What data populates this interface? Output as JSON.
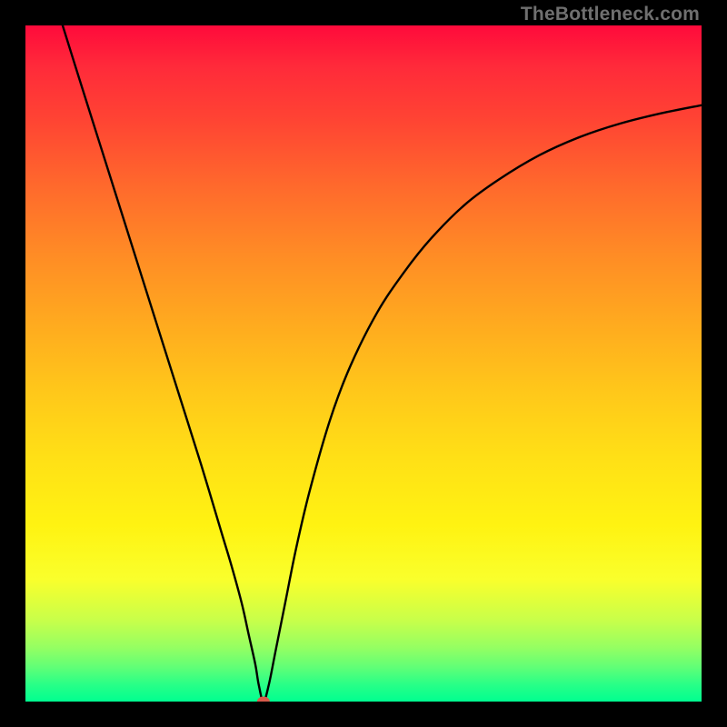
{
  "watermark": "TheBottleneck.com",
  "chart_data": {
    "type": "line",
    "title": "",
    "xlabel": "",
    "ylabel": "",
    "xlim": [
      0,
      1
    ],
    "ylim": [
      0,
      1
    ],
    "annotations": [
      "minimum-marker"
    ],
    "series": [
      {
        "name": "bottleneck-curve",
        "x": [
          0.055,
          0.08,
          0.11,
          0.14,
          0.17,
          0.2,
          0.23,
          0.26,
          0.29,
          0.305,
          0.32,
          0.33,
          0.34,
          0.345,
          0.352,
          0.36,
          0.37,
          0.385,
          0.4,
          0.42,
          0.45,
          0.48,
          0.52,
          0.56,
          0.6,
          0.65,
          0.7,
          0.76,
          0.82,
          0.88,
          0.94,
          1.0
        ],
        "y": [
          1.0,
          0.92,
          0.825,
          0.73,
          0.635,
          0.54,
          0.445,
          0.35,
          0.25,
          0.2,
          0.145,
          0.1,
          0.055,
          0.025,
          0.0,
          0.025,
          0.075,
          0.15,
          0.225,
          0.31,
          0.415,
          0.495,
          0.575,
          0.635,
          0.685,
          0.735,
          0.772,
          0.808,
          0.835,
          0.855,
          0.87,
          0.882
        ]
      }
    ],
    "marker": {
      "x": 0.352,
      "y": 0.0,
      "color": "#d85a4a"
    }
  },
  "colors": {
    "frame": "#000000",
    "curve": "#000000",
    "marker": "#d85a4a"
  }
}
